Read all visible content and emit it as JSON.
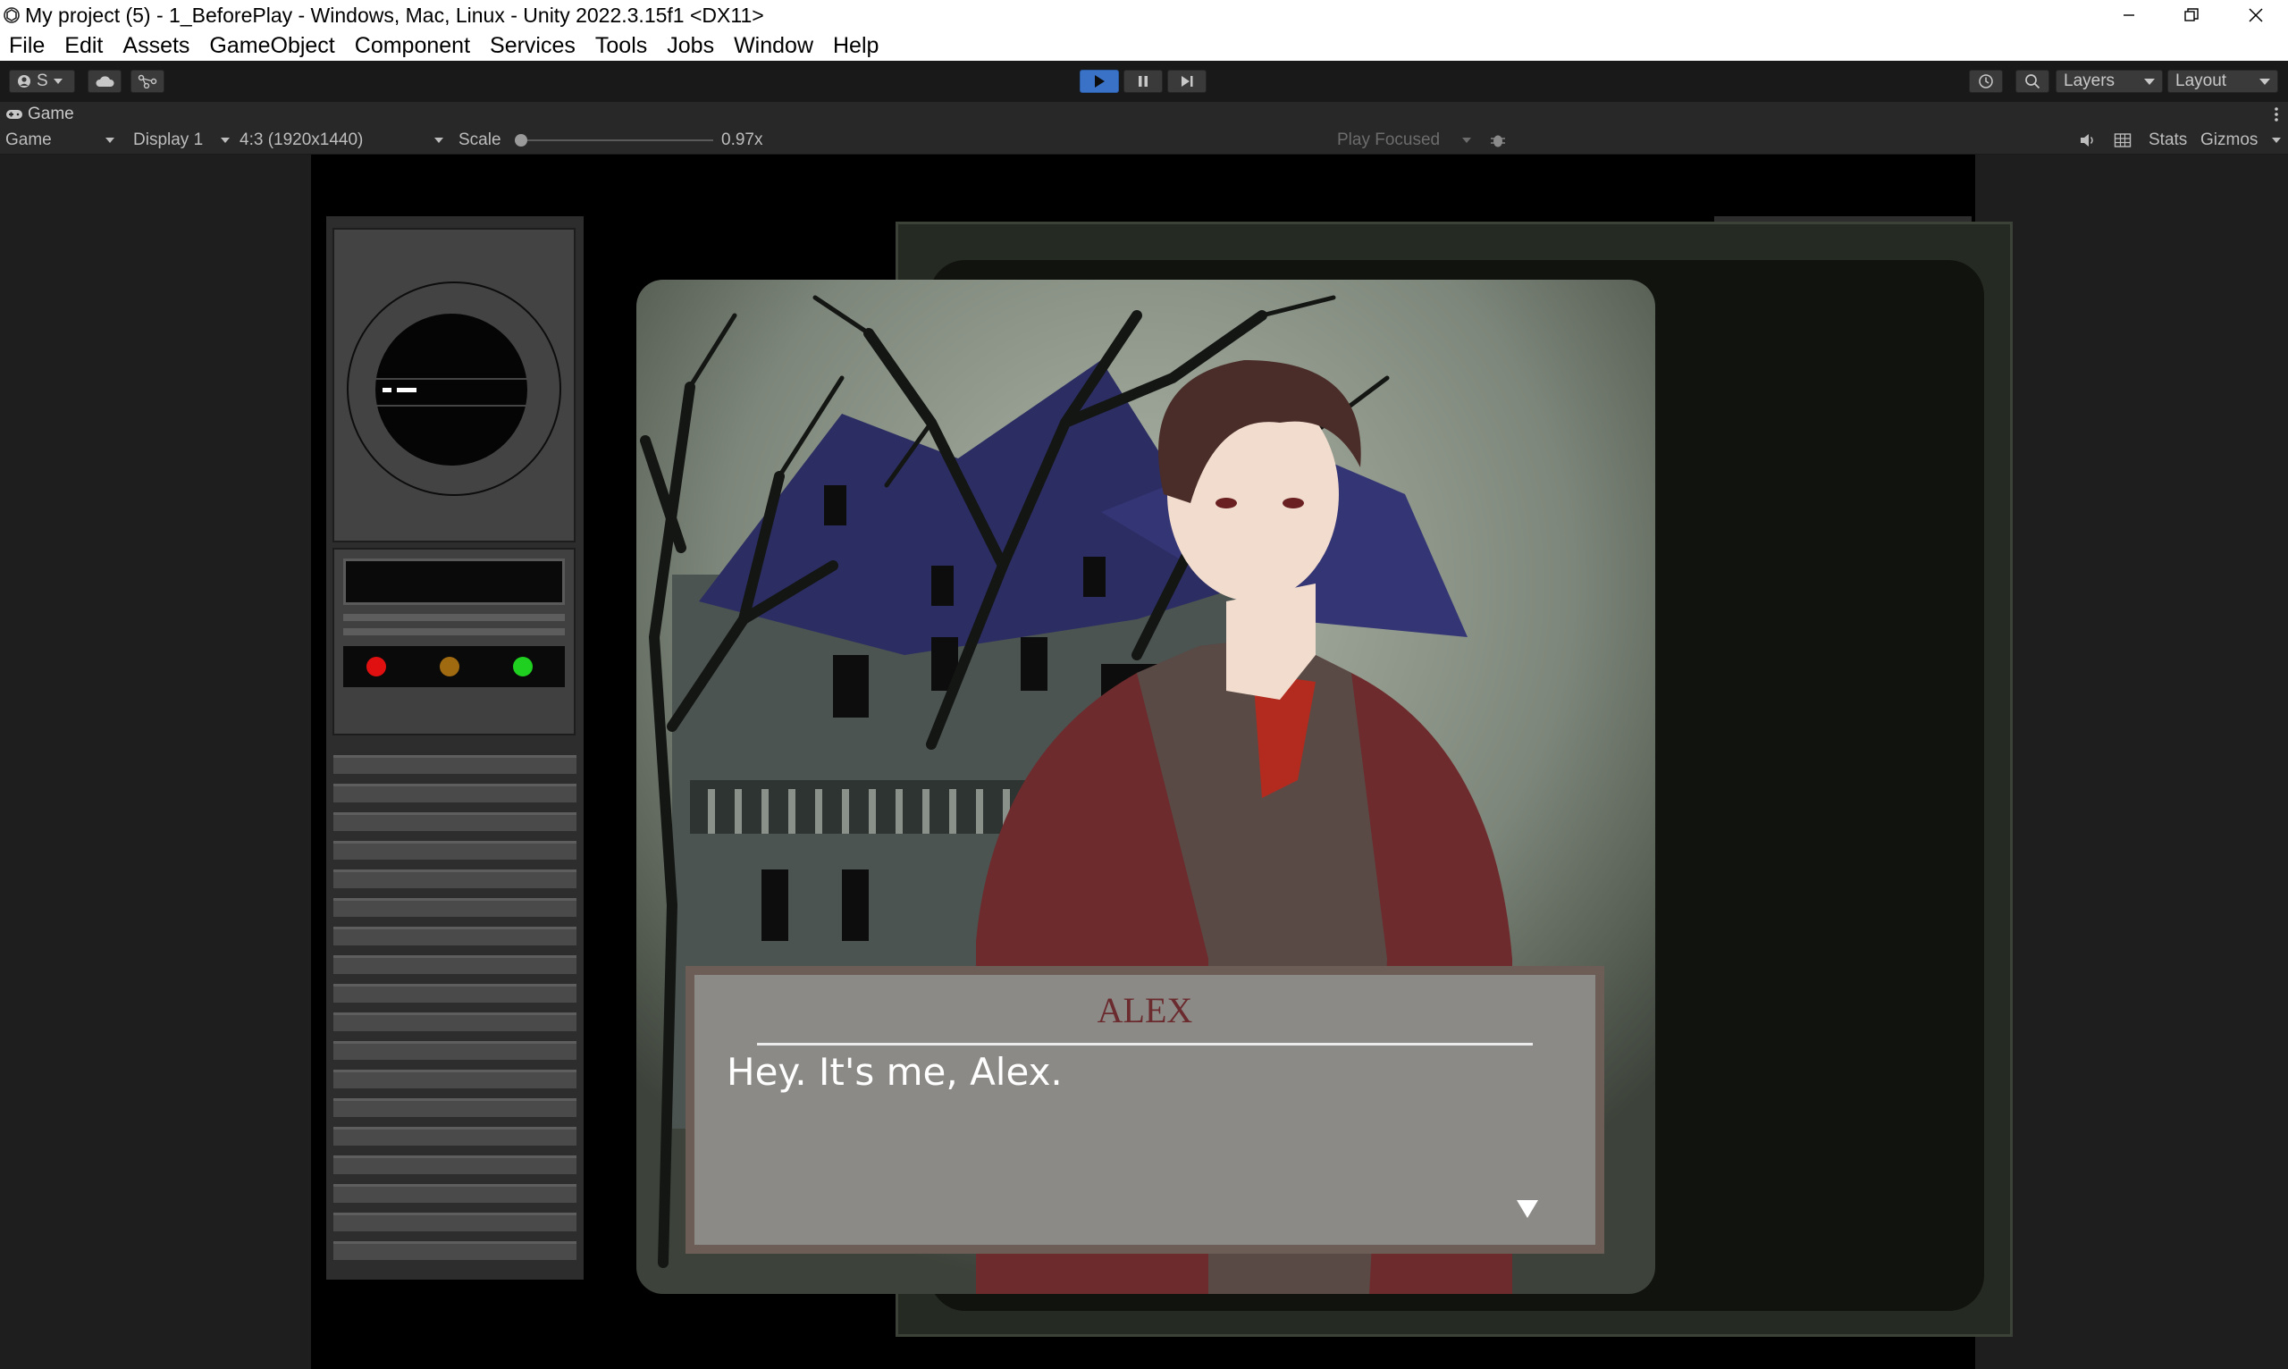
{
  "window": {
    "title": "My project (5) - 1_BeforePlay - Windows, Mac, Linux - Unity 2022.3.15f1 <DX11>"
  },
  "menu": [
    "File",
    "Edit",
    "Assets",
    "GameObject",
    "Component",
    "Services",
    "Tools",
    "Jobs",
    "Window",
    "Help"
  ],
  "toolbar": {
    "account_label": "S",
    "layers_label": "Layers",
    "layout_label": "Layout"
  },
  "game_tab": {
    "label": "Game"
  },
  "game_bar": {
    "view_mode": "Game",
    "display": "Display 1",
    "aspect": "4:3 (1920x1440)",
    "scale_label": "Scale",
    "scale_value": "0.97x",
    "scale_fraction": 0.0,
    "play_mode": "Play Focused",
    "stats_label": "Stats",
    "gizmos_label": "Gizmos"
  },
  "game": {
    "speaker": "ALEX",
    "dialog": "Hey. It's me, Alex.",
    "lights": [
      "#e01010",
      "#a06a10",
      "#20d020"
    ]
  },
  "colors": {
    "play_active": "#3a72c8",
    "editor_bg": "#1e1e1e",
    "speaker": "#6a2a2e"
  }
}
